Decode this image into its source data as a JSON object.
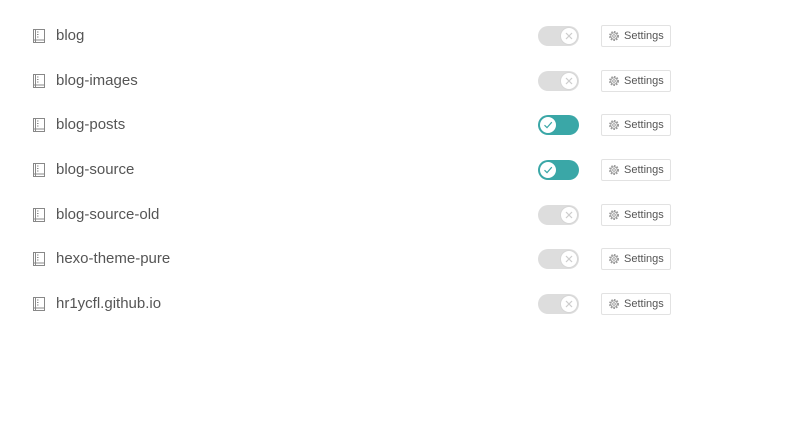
{
  "colors": {
    "toggle_on": "#3aa7a7",
    "toggle_off": "#dddddd",
    "text": "#555555"
  },
  "repos": [
    {
      "name": "blog",
      "enabled": false,
      "settings_label": "Settings",
      "icon": "repo-icon",
      "settings_icon": "gear-icon"
    },
    {
      "name": "blog-images",
      "enabled": false,
      "settings_label": "Settings",
      "icon": "repo-icon",
      "settings_icon": "gear-icon"
    },
    {
      "name": "blog-posts",
      "enabled": true,
      "settings_label": "Settings",
      "icon": "repo-icon",
      "settings_icon": "gear-icon"
    },
    {
      "name": "blog-source",
      "enabled": true,
      "settings_label": "Settings",
      "icon": "repo-icon",
      "settings_icon": "gear-icon"
    },
    {
      "name": "blog-source-old",
      "enabled": false,
      "settings_label": "Settings",
      "icon": "repo-icon",
      "settings_icon": "gear-icon"
    },
    {
      "name": "hexo-theme-pure",
      "enabled": false,
      "settings_label": "Settings",
      "icon": "repo-icon",
      "settings_icon": "gear-icon"
    },
    {
      "name": "hr1ycfl.github.io",
      "enabled": false,
      "settings_label": "Settings",
      "icon": "repo-icon",
      "settings_icon": "gear-icon"
    }
  ]
}
